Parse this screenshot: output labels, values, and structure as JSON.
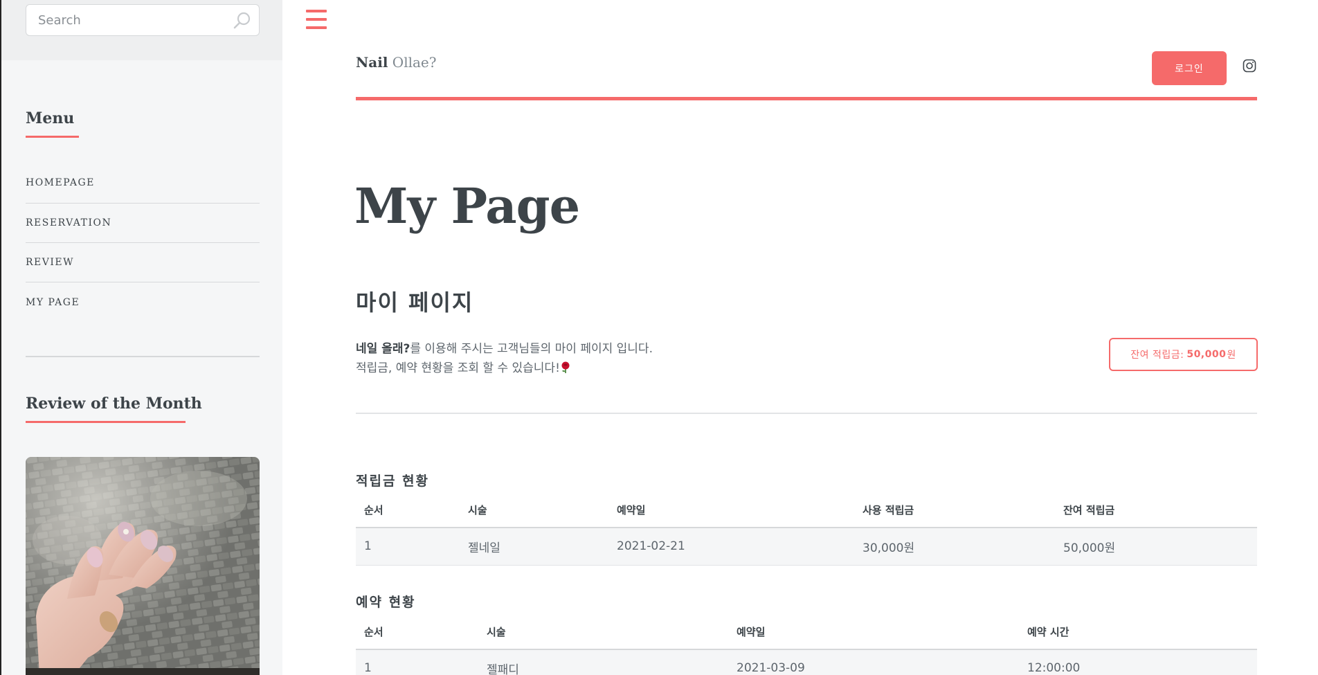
{
  "search": {
    "placeholder": "Search"
  },
  "sidebar": {
    "menu_heading": "Menu",
    "items": [
      {
        "label": "HOMEPAGE"
      },
      {
        "label": "RESERVATION"
      },
      {
        "label": "REVIEW"
      },
      {
        "label": "MY PAGE"
      }
    ],
    "review_heading": "Review of the Month"
  },
  "header": {
    "brand_strong": "Nail",
    "brand_light": "Ollae?",
    "login_label": "로그인"
  },
  "main": {
    "page_title": "My Page",
    "sub_title": "마이 페이지",
    "intro_bold": "네일 올래?",
    "intro_rest": "를 이용해 주시는 고객님들의 마이 페이지 입니다.",
    "intro_line2": "적립금, 예약 현황을 조회 할 수 있습니다!",
    "points_label": "잔여 적립금:",
    "points_amount": "50,000",
    "points_unit": "원"
  },
  "points_table": {
    "title": "적립금 현황",
    "headers": [
      "순서",
      "시술",
      "예약일",
      "사용 적립금",
      "잔여 적립금"
    ],
    "rows": [
      [
        "1",
        "젤네일",
        "2021-02-21",
        "30,000원",
        "50,000원"
      ]
    ]
  },
  "reserve_table": {
    "title": "예약 현황",
    "headers": [
      "순서",
      "시술",
      "예약일",
      "예약 시간"
    ],
    "rows": [
      [
        "1",
        "젤패디",
        "2021-03-09",
        "12:00:00"
      ]
    ]
  },
  "colors": {
    "accent": "#f56a6a",
    "text": "#3d4449",
    "sidebar_bg": "#f5f6f7"
  },
  "icons": [
    "search-icon",
    "hamburger-icon",
    "instagram-icon",
    "rose-emoji-icon"
  ]
}
